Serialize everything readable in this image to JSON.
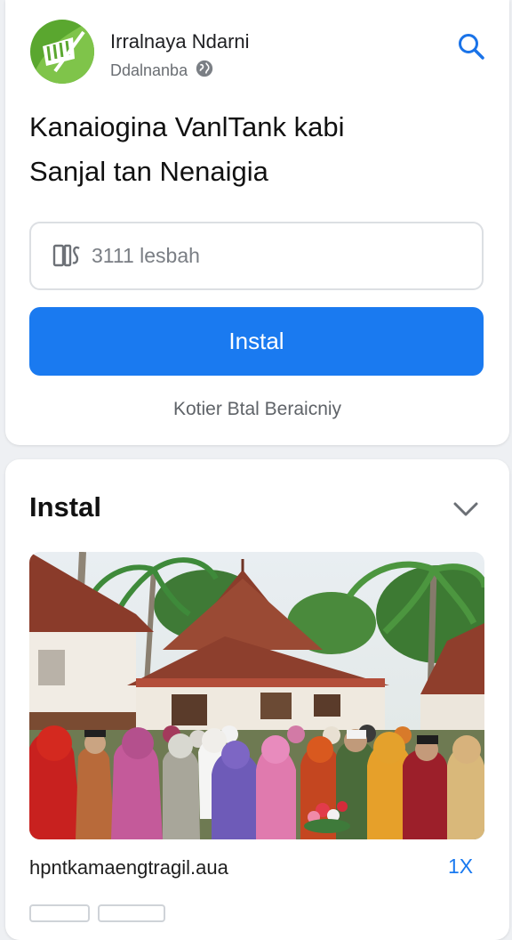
{
  "header": {
    "app_name": "Irralnaya Ndarni",
    "app_sub": "Ddalnanba",
    "icons": {
      "logo": "app-logo",
      "globe": "globe-icon",
      "search": "search-icon"
    },
    "brand_color": "#5aa72f"
  },
  "headline": {
    "line1": "Kanaiogina VanlTank kabi",
    "line2": "Sanjal tan Nenaigia"
  },
  "field": {
    "value": "3111 lesbah",
    "icon": "phone-icon"
  },
  "install": {
    "label": "Instal",
    "color": "#1a7af0"
  },
  "subnote": "Kotier Btal Beraicniy",
  "section": {
    "title": "Instal",
    "icon": "chevron-down-icon",
    "caption": "hpntkamaengtragil.aua",
    "count": "1X"
  }
}
